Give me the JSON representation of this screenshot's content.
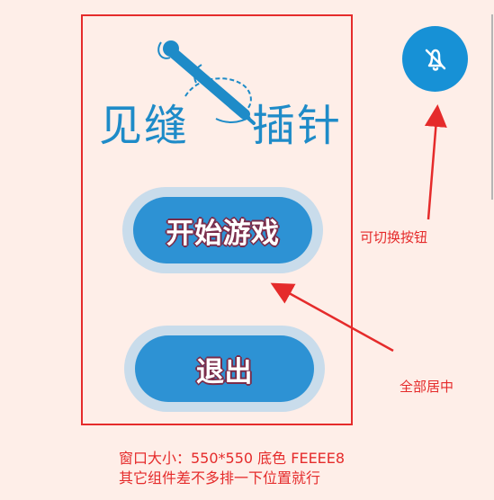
{
  "logo": {
    "left_text": "见缝",
    "right_text": "插针",
    "icon": "needle-icon"
  },
  "buttons": {
    "start_label": "开始游戏",
    "exit_label": "退出"
  },
  "sound_toggle": {
    "icon": "bell-off-icon"
  },
  "annotations": {
    "toggle_note": "可切换按钮",
    "center_note": "全部居中",
    "footer_line1": "窗口大小：550*550 底色 FEEEE8",
    "footer_line2": "其它组件差不多排一下位置就行"
  },
  "colors": {
    "background": "#FEEEE8",
    "annotation_red": "#E52B2B",
    "button_blue": "#2D92D4",
    "button_ring": "#C9DCEB",
    "sound_blue": "#1791D6",
    "logo_blue": "#1E8BC8"
  }
}
